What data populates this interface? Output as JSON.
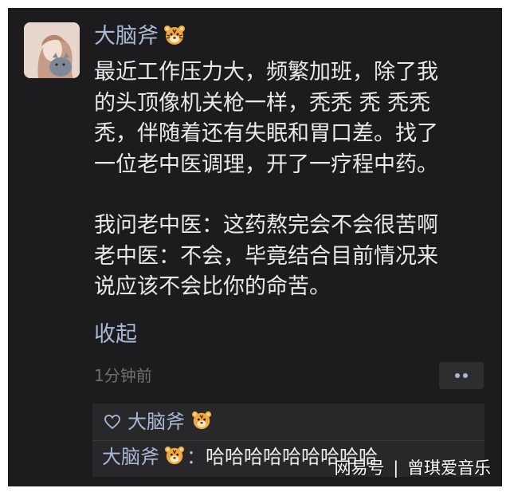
{
  "post": {
    "author": "大脑斧",
    "author_badge_icon": "tiger-face-emoji",
    "body_lines": [
      "最近工作压力大，频繁加班，除了我",
      "的头顶像机关枪一样，秃秃 秃 秃秃",
      "秃，伴随着还有失眠和胃口差。找了",
      "一位老中医调理，开了一疗程中药。",
      "",
      "我问老中医：这药熬完会不会很苦啊",
      "老中医：不会，毕竟结合目前情况来",
      "说应该不会比你的命苦。"
    ],
    "collapse_label": "收起",
    "timestamp": "1分钟前",
    "more_icon": "more-dots-icon"
  },
  "likes": {
    "icon": "heart-outline-icon",
    "name": "大脑斧"
  },
  "comment": {
    "author": "大脑斧",
    "separator": "：",
    "text": "哈哈哈哈哈哈哈哈哈"
  },
  "watermark": {
    "brand": "网易号",
    "divider": "|",
    "account": "曾琪爱音乐"
  },
  "colors": {
    "background": "#1c1c1e",
    "name_link": "#aab8d6",
    "body_text": "#e9e9ea",
    "muted_text": "#6f6f74",
    "comment_bg": "#28282a"
  }
}
